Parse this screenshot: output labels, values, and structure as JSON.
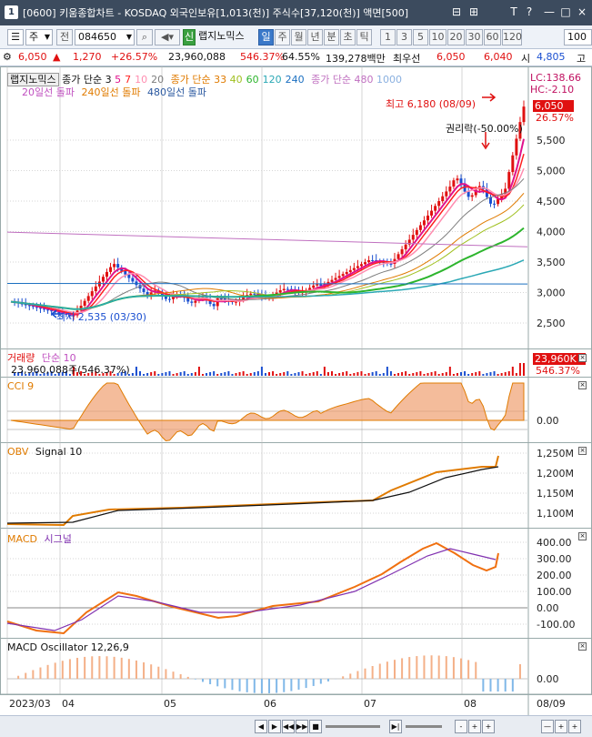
{
  "window": {
    "number": "1",
    "title": "[0600] 키움종합차트 - KOSDAQ 외국인보유[1,013(천)] 주식수[37,120(천)] 액면[500]",
    "buttons": [
      "⊟",
      "⊞",
      "T",
      "?",
      "—",
      "□",
      "×"
    ]
  },
  "toolbar": {
    "type_value": "주",
    "before_label": "전",
    "code_value": "084650",
    "signal_label": "신",
    "stock_name": "랩지노믹스",
    "period_buttons": [
      "일",
      "주",
      "월",
      "년",
      "분",
      "초",
      "틱"
    ],
    "active_period": "일",
    "interval_buttons": [
      "1",
      "3",
      "5",
      "10",
      "20",
      "30",
      "60",
      "120"
    ],
    "count_value": "100"
  },
  "quote": {
    "price": "6,050",
    "change_arrow": "▲",
    "change": "1,270",
    "change_pct": "+26.57%",
    "volume": "23,960,088",
    "volume_ratio": "546.37%",
    "turnover": "64.55%",
    "amount": "139,278백만",
    "best_ask_label": "최우선",
    "best_ask": "6,050",
    "best_bid": "6,040",
    "open_label": "시",
    "open": "4,805",
    "high_label": "고"
  },
  "price_panel": {
    "legend_name": "랩지노믹스",
    "legend_close": "종가 단순 3",
    "ma_periods": [
      "5",
      "7",
      "10",
      "20"
    ],
    "ma_legend2": "종가 단순 33",
    "ma_periods2": [
      "40",
      "60",
      "120",
      "240"
    ],
    "ma_legend3": "종가 단순 480",
    "ma_periods3": [
      "1000"
    ],
    "breakout_legends": [
      "20일선 돌파",
      "240일선 돌파",
      "480일선 돌파"
    ],
    "lc": "LC:138.66",
    "hc": "HC:-2.10",
    "high_label": "최고 6,180 (08/09)",
    "low_label": "최저 2,535 (03/30)",
    "rights_label": "권리락(-50.00%)",
    "last_price": "6,050",
    "last_pct": "26.57%",
    "y_ticks": [
      "5,500",
      "5,000",
      "4,500",
      "4,000",
      "3,500",
      "3,000",
      "2,500"
    ]
  },
  "volume_panel": {
    "legend": "거래량",
    "legend2": "단순 10",
    "value_text": "23,960,088주(546.37%)",
    "last_value": "23,960K",
    "last_pct": "546.37%"
  },
  "cci_panel": {
    "legend": "CCI 9",
    "y_ticks": [
      "0.00"
    ]
  },
  "obv_panel": {
    "legend": "OBV",
    "legend2": "Signal 10",
    "y_ticks": [
      "1,250M",
      "1,200M",
      "1,150M",
      "1,100M"
    ]
  },
  "macd_panel": {
    "legend": "MACD",
    "legend2": "시그널",
    "y_ticks": [
      "400.00",
      "300.00",
      "200.00",
      "100.00",
      "0.00",
      "-100.00"
    ]
  },
  "osc_panel": {
    "legend": "MACD Oscillator 12,26,9",
    "y_ticks": [
      "0.00"
    ]
  },
  "x_axis": {
    "labels": [
      "2023/03",
      "04",
      "05",
      "06",
      "07",
      "08"
    ],
    "right_label": "08/09"
  },
  "bottom_bar": {
    "buttons": [
      "◀",
      "▶",
      "◀◀",
      "▶▶",
      "■",
      "▶|",
      "-",
      "+",
      "+",
      "—",
      "+",
      "+"
    ]
  },
  "colors": {
    "up": "#e01010",
    "down": "#1a4fd0",
    "ma5": "#e0118c",
    "ma7": "#ff2020",
    "ma10": "#ff8db0",
    "ma20": "#7d7d7d",
    "ma33": "#e07b00",
    "ma40": "#a0c020",
    "ma60": "#2db52d",
    "ma120": "#2aa8b5",
    "ma240": "#1a6fc0",
    "ma480": "#c070c0",
    "ma1000": "#8ab0e0",
    "macd": "#f07010",
    "signal": "#8030b0",
    "cci_fill": "#f0a070",
    "cci_neg": "#80b8e8"
  }
}
